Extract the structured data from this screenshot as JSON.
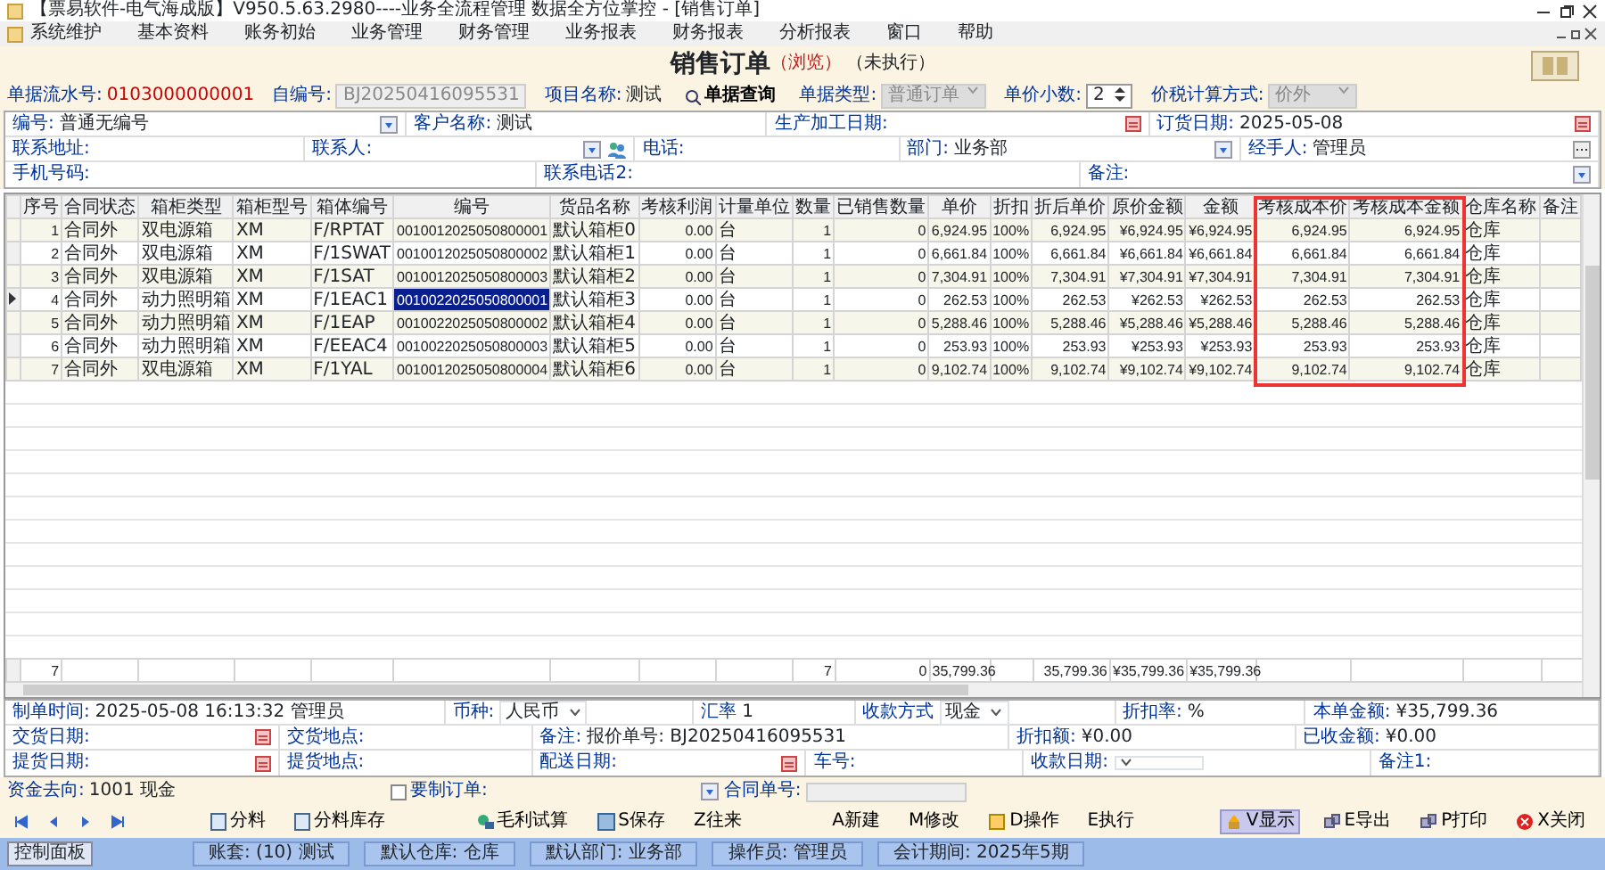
{
  "window": {
    "title": "【票易软件-电气海成版】V950.5.63.2980----业务全流程管理 数据全方位掌控 - [销售订单]"
  },
  "menu": [
    "系统维护",
    "基本资料",
    "账务初始",
    "业务管理",
    "财务管理",
    "业务报表",
    "财务报表",
    "分析报表",
    "窗口",
    "帮助"
  ],
  "document": {
    "title": "销售订单",
    "mode": "（浏览）",
    "state": "（未执行）"
  },
  "header_fields": [
    {
      "kind": "serial",
      "label": "单据流水号:",
      "value": "0103000000001"
    },
    {
      "kind": "readonly",
      "label": "自编号:",
      "value": "BJ20250416095531"
    },
    {
      "kind": "text",
      "label": "项目名称:",
      "value": "测试"
    },
    {
      "kind": "button",
      "label": "单据查询"
    },
    {
      "kind": "locked-select",
      "label": "单据类型:",
      "value": "普通订单"
    },
    {
      "kind": "spinner",
      "label": "单价小数:",
      "value": "2"
    },
    {
      "kind": "locked-select",
      "label": "价税计算方式:",
      "value": "价外"
    }
  ],
  "form_rows": [
    [
      {
        "kind": "lookup",
        "label": "编号:",
        "value": "普通无编号"
      },
      {
        "kind": "text",
        "label": "客户名称:",
        "value": "测试"
      },
      {
        "kind": "date",
        "label": "生产加工日期:"
      },
      {
        "kind": "date",
        "label": "订货日期:",
        "value": "2025-05-08"
      }
    ],
    [
      {
        "kind": "text",
        "label": "联系地址:"
      },
      {
        "kind": "contact",
        "label": "联系人:"
      },
      {
        "kind": "text",
        "label": "电话:"
      },
      {
        "kind": "lookup",
        "label": "部门:",
        "value": "业务部"
      },
      {
        "kind": "more",
        "label": "经手人:",
        "value": "管理员"
      }
    ],
    [
      {
        "kind": "text",
        "label": "手机号码:"
      },
      {
        "kind": "text",
        "label": "联系电话2:"
      },
      {
        "kind": "lookup",
        "label": "备注:"
      }
    ]
  ],
  "table": {
    "columns": [
      {
        "label": "序号",
        "outlined": false
      },
      {
        "label": "合同状态",
        "outlined": false
      },
      {
        "label": "箱柜类型",
        "outlined": false
      },
      {
        "label": "箱柜型号",
        "outlined": false
      },
      {
        "label": "箱体编号",
        "outlined": false
      },
      {
        "label": "编号",
        "outlined": false,
        "selected": true
      },
      {
        "label": "货品名称",
        "outlined": false
      },
      {
        "label": "考核利润",
        "outlined": false
      },
      {
        "label": "计量单位",
        "outlined": false
      },
      {
        "label": "数量",
        "outlined": false
      },
      {
        "label": "已销售数量",
        "outlined": false
      },
      {
        "label": "单价",
        "outlined": false
      },
      {
        "label": "折扣",
        "outlined": false
      },
      {
        "label": "折后单价",
        "outlined": false
      },
      {
        "label": "原价金额",
        "outlined": false
      },
      {
        "label": "金额",
        "outlined": false
      },
      {
        "label": "考核成本价",
        "outlined": true
      },
      {
        "label": "考核成本金额",
        "outlined": true
      },
      {
        "label": "仓库名称",
        "outlined": false
      },
      {
        "label": "备注",
        "outlined": false
      }
    ],
    "rows": [
      {
        "selected": false,
        "cells": [
          "1",
          "合同外",
          "双电源箱",
          "XM",
          "F/RPTAT",
          "0010012025050800001",
          "默认箱柜0",
          "0.00",
          "台",
          "1",
          "0",
          "6,924.95",
          "100%",
          "6,924.95",
          "¥6,924.95",
          "¥6,924.95",
          "6,924.95",
          "6,924.95",
          "仓库"
        ]
      },
      {
        "selected": false,
        "cells": [
          "2",
          "合同外",
          "双电源箱",
          "XM",
          "F/1SWAT",
          "0010012025050800002",
          "默认箱柜1",
          "0.00",
          "台",
          "1",
          "0",
          "6,661.84",
          "100%",
          "6,661.84",
          "¥6,661.84",
          "¥6,661.84",
          "6,661.84",
          "6,661.84",
          "仓库"
        ]
      },
      {
        "selected": false,
        "cells": [
          "3",
          "合同外",
          "双电源箱",
          "XM",
          "F/1SAT",
          "0010012025050800003",
          "默认箱柜2",
          "0.00",
          "台",
          "1",
          "0",
          "7,304.91",
          "100%",
          "7,304.91",
          "¥7,304.91",
          "¥7,304.91",
          "7,304.91",
          "7,304.91",
          "仓库"
        ]
      },
      {
        "selected": true,
        "cells": [
          "4",
          "合同外",
          "动力照明箱",
          "XM",
          "F/1EAC1",
          "0010022025050800001",
          "默认箱柜3",
          "0.00",
          "台",
          "1",
          "0",
          "262.53",
          "100%",
          "262.53",
          "¥262.53",
          "¥262.53",
          "262.53",
          "262.53",
          "仓库"
        ]
      },
      {
        "selected": false,
        "cells": [
          "5",
          "合同外",
          "动力照明箱",
          "XM",
          "F/1EAP",
          "0010022025050800002",
          "默认箱柜4",
          "0.00",
          "台",
          "1",
          "0",
          "5,288.46",
          "100%",
          "5,288.46",
          "¥5,288.46",
          "¥5,288.46",
          "5,288.46",
          "5,288.46",
          "仓库"
        ]
      },
      {
        "selected": false,
        "cells": [
          "6",
          "合同外",
          "动力照明箱",
          "XM",
          "F/EEAC4",
          "0010022025050800003",
          "默认箱柜5",
          "0.00",
          "台",
          "1",
          "0",
          "253.93",
          "100%",
          "253.93",
          "¥253.93",
          "¥253.93",
          "253.93",
          "253.93",
          "仓库"
        ]
      },
      {
        "selected": false,
        "cells": [
          "7",
          "合同外",
          "双电源箱",
          "XM",
          "F/1YAL",
          "0010012025050800004",
          "默认箱柜6",
          "0.00",
          "台",
          "1",
          "0",
          "9,102.74",
          "100%",
          "9,102.74",
          "¥9,102.74",
          "¥9,102.74",
          "9,102.74",
          "9,102.74",
          "仓库"
        ]
      }
    ],
    "total": {
      "row_count": "7",
      "quantity": "7",
      "sold_quantity": "0",
      "unit_price": "35,799.36",
      "net_unit_price": "35,799.36",
      "list_amount": "¥35,799.36",
      "amount": "¥35,799.36"
    }
  },
  "footer_rows": [
    [
      {
        "kind": "text",
        "label": "制单时间:",
        "value": "2025-05-08 16:13:32 管理员"
      },
      {
        "kind": "select",
        "label": "币种:",
        "value": "人民币"
      },
      {
        "kind": "number",
        "label": "汇率",
        "value": "1"
      },
      {
        "kind": "select",
        "label": "收款方式",
        "value": "现金"
      },
      {
        "kind": "text",
        "label": "折扣率:",
        "value": "%"
      },
      {
        "kind": "amount",
        "label": "本单金额:",
        "value": "¥35,799.36"
      }
    ],
    [
      {
        "kind": "date",
        "label": "交货日期:"
      },
      {
        "kind": "text",
        "label": "交货地点:"
      },
      {
        "kind": "text",
        "label": "备注:",
        "value": "报价单号: BJ20250416095531"
      },
      {
        "kind": "text",
        "label": "折扣额:",
        "value": "¥0.00"
      },
      {
        "kind": "amount",
        "label": "已收金额:",
        "value": "¥0.00"
      }
    ],
    [
      {
        "kind": "date",
        "label": "提货日期:"
      },
      {
        "kind": "text",
        "label": "提货地点:"
      },
      {
        "kind": "date",
        "label": "配送日期:"
      },
      {
        "kind": "text",
        "label": "车号:"
      },
      {
        "kind": "select",
        "label": "收款日期:"
      },
      {
        "kind": "text",
        "label": "备注1:"
      }
    ]
  ],
  "fund_row": [
    {
      "kind": "text",
      "label": "资金去向:",
      "value": "1001 现金"
    },
    {
      "kind": "check",
      "label": "要制订单:"
    },
    {
      "kind": "lookup",
      "label": "合同单号:"
    }
  ],
  "left_tools": [
    "分料",
    "分料库存"
  ],
  "right_tools": [
    {
      "label": "毛利试算",
      "pressed": false
    },
    {
      "label": "S保存",
      "pressed": false
    },
    {
      "label": "Z往来",
      "pressed": false
    },
    {
      "label": "A新建",
      "pressed": false
    },
    {
      "label": "M修改",
      "pressed": false
    },
    {
      "label": "D操作",
      "pressed": false
    },
    {
      "label": "E执行",
      "pressed": false
    },
    {
      "label": "V显示",
      "pressed": true
    },
    {
      "label": "E导出",
      "pressed": false
    },
    {
      "label": "P打印",
      "pressed": false
    },
    {
      "label": "X关闭",
      "pressed": false
    }
  ],
  "status_bar": {
    "tabs": [
      {
        "label": "控制面板",
        "selected": false
      }
    ],
    "cells": [
      "账套: (10) 测试",
      "默认仓库: 仓库",
      "默认部门: 业务部",
      "操作员: 管理员",
      "会计期间: 2025年5期"
    ]
  }
}
